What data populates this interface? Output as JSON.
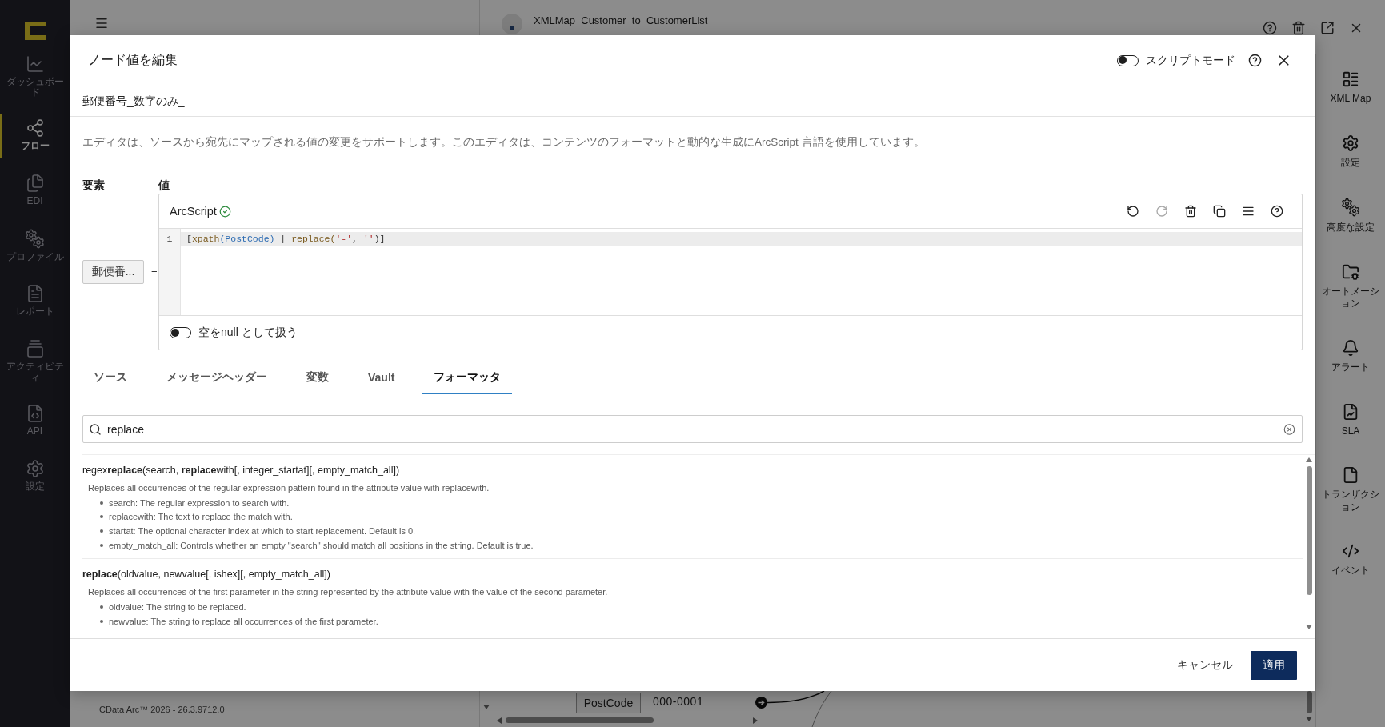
{
  "nav": {
    "items": [
      {
        "label": "ダッシュボード",
        "selected": false
      },
      {
        "label": "フロー",
        "selected": true
      },
      {
        "label": "EDI",
        "selected": false
      },
      {
        "label": "プロファイル",
        "selected": false
      },
      {
        "label": "レポート",
        "selected": false
      },
      {
        "label": "アクティビティ",
        "selected": false
      },
      {
        "label": "API",
        "selected": false
      },
      {
        "label": "設定",
        "selected": false
      }
    ]
  },
  "flow_header": {
    "title": "XMLMap_Customer_to_CustomerList"
  },
  "side_panel": {
    "items": [
      {
        "label": "XML Map"
      },
      {
        "label": "設定"
      },
      {
        "label": "高度な設定"
      },
      {
        "label": "オートメーション"
      },
      {
        "label": "アラート"
      },
      {
        "label": "SLA"
      },
      {
        "label": "トランザクション"
      },
      {
        "label": "イベント"
      }
    ]
  },
  "footer": {
    "version": "CData Arc™ 2026 - 26.3.9712.0"
  },
  "canvas": {
    "node": {
      "name": "PostCode",
      "value": "000-0001"
    }
  },
  "dialog": {
    "title": "ノード値を編集",
    "script_mode": {
      "label": "スクリプトモード",
      "on": false
    },
    "node_name": "郵便番号_数字のみ_",
    "description": "エディタは、ソースから宛先にマップされる値の変更をサポートします。このエディタは、コンテンツのフォーマットと動的な生成にArcScript 言語を使用しています。",
    "element_label": "要素",
    "value_label": "値",
    "element_button": "郵便番...",
    "equals": "=",
    "editor": {
      "language": "ArcScript",
      "valid": true,
      "toolbar": [
        {
          "disabled": false
        },
        {
          "disabled": true
        },
        {
          "disabled": false
        },
        {
          "disabled": false
        },
        {
          "disabled": false
        },
        {
          "disabled": false
        }
      ],
      "lines": [
        {
          "number": "1",
          "current": true,
          "tokens": [
            {
              "text": "[",
              "kind": "punct"
            },
            {
              "text": "xpath",
              "kind": "function"
            },
            {
              "text": "(PostCode)",
              "kind": "path"
            },
            {
              "text": " | ",
              "kind": "punct"
            },
            {
              "text": "replace(",
              "kind": "function"
            },
            {
              "text": "'-'",
              "kind": "string"
            },
            {
              "text": ", ",
              "kind": "punct"
            },
            {
              "text": "''",
              "kind": "string"
            },
            {
              "text": ")]",
              "kind": "punct"
            }
          ]
        }
      ],
      "empty_as_null": {
        "label": "空をnull として扱う",
        "on": false
      }
    },
    "tabs": [
      {
        "label": "ソース",
        "selected": false
      },
      {
        "label": "メッセージヘッダー",
        "selected": false
      },
      {
        "label": "変数",
        "selected": false
      },
      {
        "label": "Vault",
        "selected": false
      },
      {
        "label": "フォーマッタ",
        "selected": true
      }
    ],
    "search": {
      "value": "replace"
    },
    "formatters": [
      {
        "signature": "regex**replace**(search, **replace**with[, integer_startat][, empty_match_all])",
        "description": "Replaces all occurrences of the regular expression pattern found in the attribute value with replacewith.",
        "params": [
          "search: The regular expression to search with.",
          "replacewith: The text to replace the match with.",
          "startat: The optional character index at which to start replacement. Default is 0.",
          "empty_match_all: Controls whether an empty \"search\" should match all positions in the string. Default is true."
        ]
      },
      {
        "signature": "**replace**(oldvalue, newvalue[, ishex][, empty_match_all])",
        "description": "Replaces all occurrences of the first parameter in the string represented by the attribute value with the value of the second parameter.",
        "params": [
          "oldvalue: The string to be replaced.",
          "newvalue: The string to replace all occurrences of the first parameter."
        ]
      }
    ],
    "buttons": {
      "cancel": "キャンセル",
      "apply": "適用"
    }
  }
}
